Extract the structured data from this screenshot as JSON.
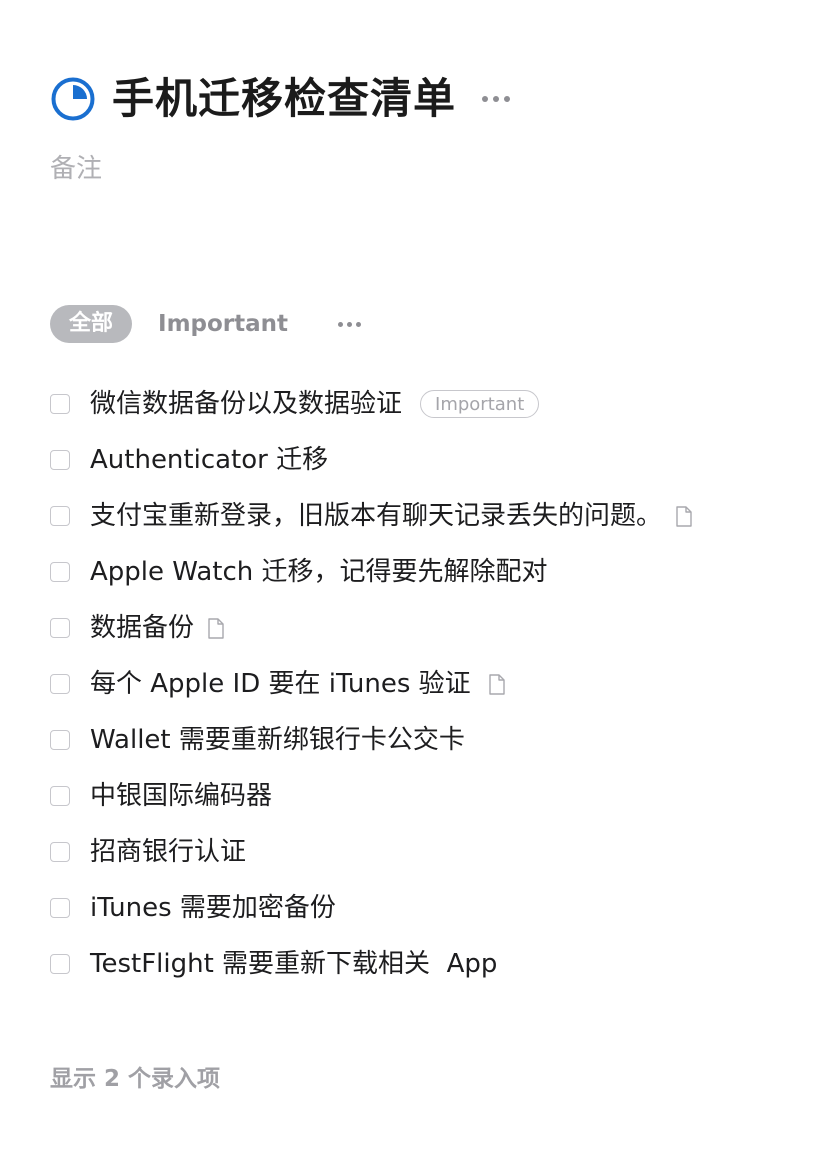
{
  "header": {
    "title": "手机迁移检查清单",
    "progress_icon": "progress-circle-icon",
    "more_icon": "more-horizontal-icon",
    "accent_color": "#1a6fd0"
  },
  "notes_placeholder": "备注",
  "filters": {
    "active": "全部",
    "tag": "Important",
    "more_icon": "more-horizontal-icon"
  },
  "tasks": [
    {
      "text": "微信数据备份以及数据验证",
      "tag": "Important",
      "has_note": false,
      "checked": false
    },
    {
      "text": "Authenticator 迁移",
      "has_note": false,
      "checked": false
    },
    {
      "text": "支付宝重新登录，旧版本有聊天记录丢失的问题。",
      "has_note": true,
      "checked": false
    },
    {
      "text": "Apple Watch 迁移，记得要先解除配对",
      "has_note": false,
      "checked": false
    },
    {
      "text": "数据备份",
      "has_note": true,
      "checked": false
    },
    {
      "text": "每个 Apple ID 要在 iTunes 验证",
      "has_note": true,
      "checked": false
    },
    {
      "text": "Wallet 需要重新绑银行卡公交卡",
      "has_note": false,
      "checked": false
    },
    {
      "text": "中银国际编码器",
      "has_note": false,
      "checked": false
    },
    {
      "text": "招商银行认证",
      "has_note": false,
      "checked": false
    },
    {
      "text": "iTunes 需要加密备份",
      "has_note": false,
      "checked": false
    },
    {
      "text": "TestFlight 需要重新下载相关  App",
      "has_note": false,
      "checked": false
    }
  ],
  "footer": {
    "show_completed": "显示 2 个录入项"
  }
}
